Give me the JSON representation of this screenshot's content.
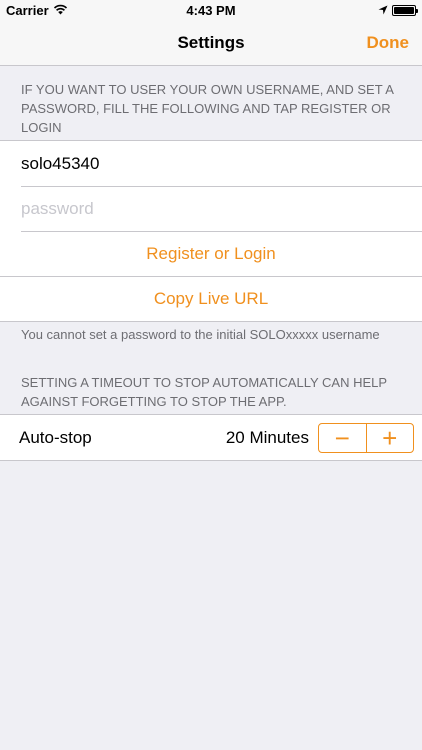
{
  "status_bar": {
    "carrier": "Carrier",
    "time": "4:43 PM"
  },
  "nav": {
    "title": "Settings",
    "done_label": "Done"
  },
  "account": {
    "header": "IF YOU WANT TO USER YOUR OWN USERNAME, AND SET A PASSWORD, FILL THE FOLLOWING AND TAP REGISTER OR LOGIN",
    "username_value": "solo45340",
    "password_placeholder": "password",
    "register_label": "Register or Login",
    "copy_url_label": "Copy Live URL",
    "footer": "You cannot set a password to the initial SOLOxxxxx username"
  },
  "timeout": {
    "header": "SETTING A TIMEOUT TO STOP AUTOMATICALLY CAN HELP AGAINST FORGETTING TO STOP THE APP.",
    "label": "Auto-stop",
    "value": "20 Minutes",
    "minus_symbol": "−",
    "plus_symbol": "+"
  },
  "colors": {
    "accent": "#f0901e",
    "background": "#efeff4",
    "secondary_text": "#6d6d72"
  }
}
